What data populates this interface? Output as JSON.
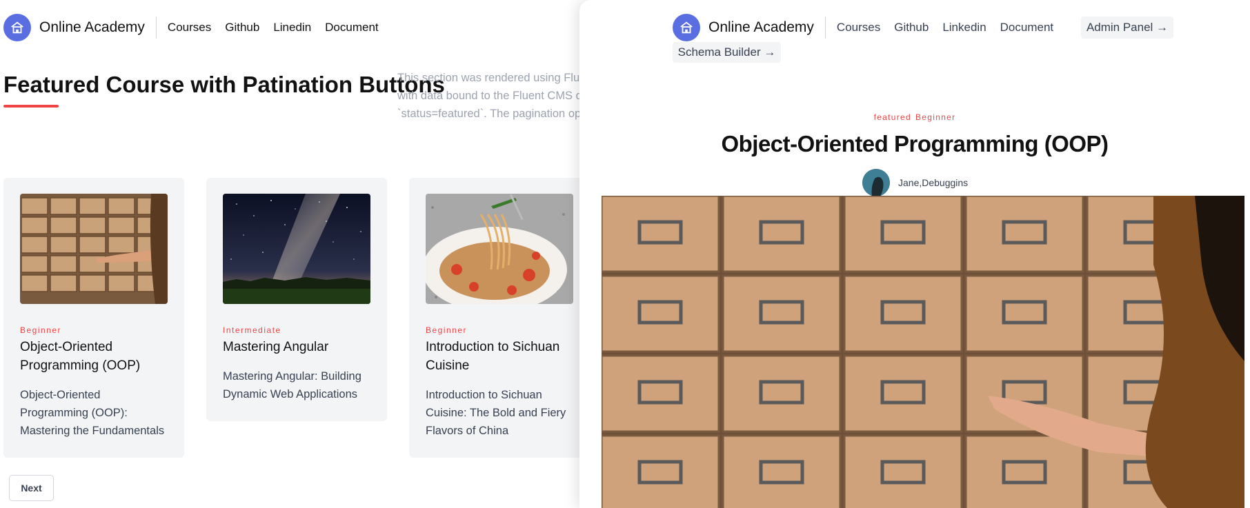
{
  "site": {
    "brand": "Online Academy",
    "home_icon": "home-icon"
  },
  "nav": {
    "left_links": [
      "Courses",
      "Github",
      "Linedin",
      "Document"
    ],
    "panel_links": [
      "Courses",
      "Github",
      "Linkedin",
      "Document"
    ]
  },
  "section": {
    "title": "Featured Course with Patination Buttons",
    "description": "This section was rendered using Flue\nwith data bound to the Fluent CMS q\n`status=featured`. The pagination op"
  },
  "cards": [
    {
      "level": "Beginner",
      "title": "Object-Oriented Programming (OOP)",
      "description": "Object-Oriented Programming (OOP): Mastering the Fundamentals",
      "image": "card-catalog-drawers"
    },
    {
      "level": "Intermediate",
      "title": "Mastering Angular",
      "description": "Mastering Angular: Building Dynamic Web Applications",
      "image": "starry-night-sky"
    },
    {
      "level": "Beginner",
      "title": "Introduction to Sichuan Cuisine",
      "description": "Introduction to Sichuan Cuisine: The Bold and Fiery Flavors of China",
      "image": "spaghetti-plate"
    }
  ],
  "pagination": {
    "next_label": "Next"
  },
  "panel": {
    "admin_label": "Admin Panel →",
    "schema_label": "Schema Builder →",
    "tag_status": "featured",
    "tag_level": "Beginner",
    "title": "Object-Oriented Programming (OOP)",
    "author": "Jane,Debuggins",
    "hero_image": "card-catalog-drawers"
  },
  "colors": {
    "accent": "#ef4444",
    "logo": "#5b6ee1",
    "card_bg": "#f3f4f6"
  }
}
